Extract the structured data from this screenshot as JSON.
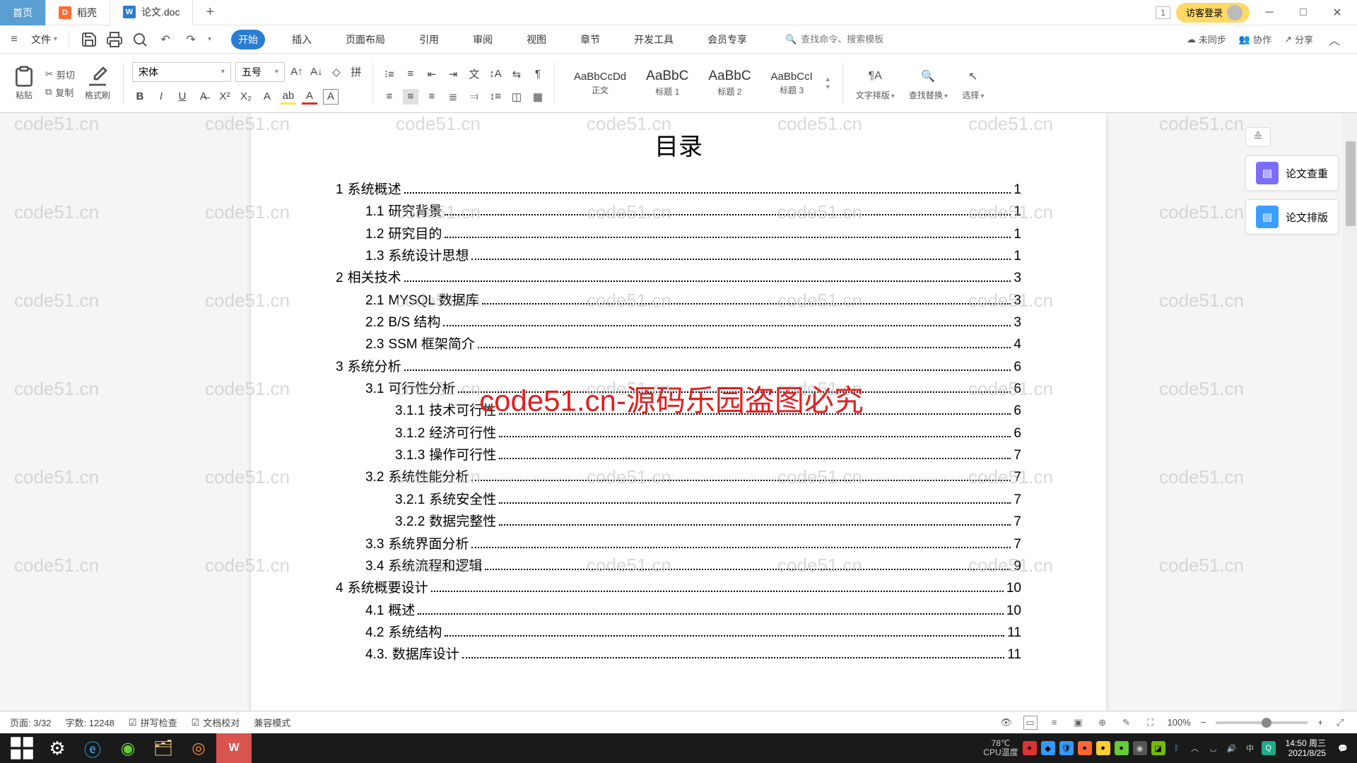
{
  "tabs": {
    "home": "首页",
    "daoke": "稻壳",
    "doc": "论文.doc"
  },
  "titlebar": {
    "badge": "1",
    "guest": "访客登录"
  },
  "menubar": {
    "file": "文件",
    "tabs": [
      "开始",
      "插入",
      "页面布局",
      "引用",
      "审阅",
      "视图",
      "章节",
      "开发工具",
      "会员专享"
    ],
    "search_placeholder": "查找命令、搜索模板",
    "unsync": "未同步",
    "collab": "协作",
    "share": "分享"
  },
  "ribbon": {
    "paste": "粘贴",
    "cut": "剪切",
    "copy": "复制",
    "format_painter": "格式刷",
    "font_name": "宋体",
    "font_size": "五号",
    "styles": [
      {
        "preview": "AaBbCcDd",
        "name": "正文"
      },
      {
        "preview": "AaBbC",
        "name": "标题 1"
      },
      {
        "preview": "AaBbC",
        "name": "标题 2"
      },
      {
        "preview": "AaBbCcI",
        "name": "标题 3"
      }
    ],
    "text_layout": "文字排版",
    "find_replace": "查找替换",
    "select": "选择"
  },
  "doc": {
    "title": "目录",
    "toc": [
      {
        "lv": 1,
        "num": "1",
        "text": "系统概述",
        "page": "1"
      },
      {
        "lv": 2,
        "num": "1.1",
        "text": "研究背景",
        "page": "1"
      },
      {
        "lv": 2,
        "num": "1.2",
        "text": "研究目的",
        "page": "1"
      },
      {
        "lv": 2,
        "num": "1.3",
        "text": "系统设计思想",
        "page": "1"
      },
      {
        "lv": 1,
        "num": "2",
        "text": "相关技术",
        "page": "3"
      },
      {
        "lv": 2,
        "num": "2.1",
        "text": "MYSQL 数据库",
        "page": "3"
      },
      {
        "lv": 2,
        "num": "2.2",
        "text": "B/S 结构",
        "page": "3"
      },
      {
        "lv": 2,
        "num": "2.3",
        "text": "SSM 框架简介",
        "page": "4"
      },
      {
        "lv": 1,
        "num": "3",
        "text": "系统分析",
        "page": "6"
      },
      {
        "lv": 2,
        "num": "3.1",
        "text": "可行性分析",
        "page": "6"
      },
      {
        "lv": 3,
        "num": "3.1.1",
        "text": "技术可行性",
        "page": "6"
      },
      {
        "lv": 3,
        "num": "3.1.2",
        "text": "经济可行性",
        "page": "6"
      },
      {
        "lv": 3,
        "num": "3.1.3",
        "text": "操作可行性",
        "page": "7"
      },
      {
        "lv": 2,
        "num": "3.2",
        "text": "系统性能分析",
        "page": "7"
      },
      {
        "lv": 3,
        "num": "3.2.1",
        "text": "系统安全性",
        "page": "7"
      },
      {
        "lv": 3,
        "num": "3.2.2",
        "text": "数据完整性",
        "page": "7"
      },
      {
        "lv": 2,
        "num": "3.3",
        "text": "系统界面分析",
        "page": "7"
      },
      {
        "lv": 2,
        "num": "3.4",
        "text": "系统流程和逻辑",
        "page": "9"
      },
      {
        "lv": 1,
        "num": "4",
        "text": "系统概要设计",
        "page": "10"
      },
      {
        "lv": 2,
        "num": "4.1",
        "text": "概述",
        "page": "10"
      },
      {
        "lv": 2,
        "num": "4.2",
        "text": "系统结构",
        "page": "11"
      },
      {
        "lv": 2,
        "num": "4.3.",
        "text": "数据库设计",
        "page": "11"
      }
    ]
  },
  "side": {
    "check": "论文查重",
    "layout": "论文排版"
  },
  "status": {
    "page": "页面: 3/32",
    "words": "字数: 12248",
    "spell": "拼写检查",
    "proof": "文档校对",
    "compat": "兼容模式",
    "zoom": "100%"
  },
  "watermark": {
    "text": "code51.cn",
    "center": "code51.cn-源码乐园盗图必究"
  },
  "taskbar": {
    "cpu_top": "78℃",
    "cpu_bot": "CPU温度",
    "time": "14:50 周三",
    "date": "2021/8/25"
  }
}
